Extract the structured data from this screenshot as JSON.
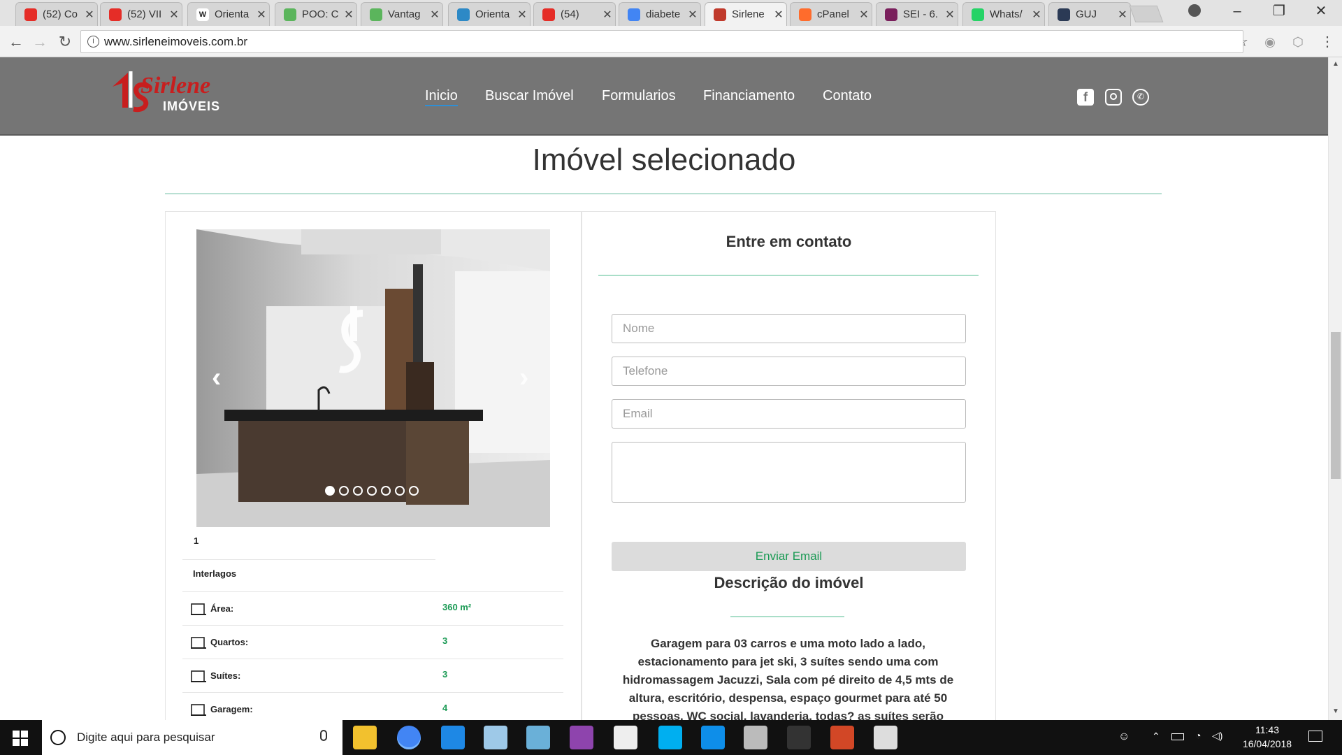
{
  "browser": {
    "tabs": [
      {
        "title": "(52) Co",
        "icon": "youtube-icon",
        "color": "#e52d27"
      },
      {
        "title": "(52) VII",
        "icon": "youtube-icon",
        "color": "#e52d27"
      },
      {
        "title": "Orienta",
        "icon": "wikipedia-icon",
        "color": "#ffffff"
      },
      {
        "title": "POO: C",
        "icon": "gear-icon",
        "color": "#5bb55c"
      },
      {
        "title": "Vantag",
        "icon": "gear-icon",
        "color": "#5bb55c"
      },
      {
        "title": "Orienta",
        "icon": "wordpress-icon",
        "color": "#2d89c6"
      },
      {
        "title": "(54)",
        "icon": "youtube-icon",
        "color": "#e52d27"
      },
      {
        "title": "diabete",
        "icon": "google-icon",
        "color": "#4285f4"
      },
      {
        "title": "Sirlene",
        "icon": "sirlene-icon",
        "color": "#c0392b"
      },
      {
        "title": "cPanel",
        "icon": "cpanel-icon",
        "color": "#ff6c2c"
      },
      {
        "title": "SEI - 6.",
        "icon": "sei-icon",
        "color": "#7a1f5c"
      },
      {
        "title": "Whats/",
        "icon": "whatsapp-icon",
        "color": "#25d366"
      },
      {
        "title": "GUJ",
        "icon": "guj-icon",
        "color": "#2b3a55"
      }
    ],
    "active_tab_index": 8,
    "url": "www.sirleneimoveis.com.br"
  },
  "site": {
    "logo_main": "Sirlene",
    "logo_sub": "IMÓVEIS",
    "menu": [
      "Inicio",
      "Buscar Imóvel",
      "Formularios",
      "Financiamento",
      "Contato"
    ],
    "social_icons": [
      "facebook-icon",
      "instagram-icon",
      "whatsapp-icon"
    ]
  },
  "page": {
    "title": "Imóvel selecionado",
    "carousel": {
      "slide_count": 7,
      "active_slide": 1
    },
    "image_caption": "1",
    "neighborhood": "Interlagos",
    "features": [
      {
        "label": "Área:",
        "value": "360 m²",
        "icon": "area-icon"
      },
      {
        "label": "Quartos:",
        "value": "3",
        "icon": "bed-icon"
      },
      {
        "label": "Suítes:",
        "value": "3",
        "icon": "bathtub-icon"
      },
      {
        "label": "Garagem:",
        "value": "4",
        "icon": "garage-icon"
      }
    ],
    "contact": {
      "title": "Entre em contato",
      "name_placeholder": "Nome",
      "phone_placeholder": "Telefone",
      "email_placeholder": "Email",
      "message_placeholder": "",
      "submit_label": "Enviar Email"
    },
    "description": {
      "title": "Descrição do imóvel",
      "lines": [
        "Garagem para 03 carros e uma moto lado a lado,",
        "estacionamento para jet ski, 3 suítes sendo uma com",
        "hidromassagem Jacuzzi, Sala com pé direito de 4,5 mts de",
        "altura, escritório, despensa, espaço gourmet para até 50",
        "pessoas, WC social, lavanderia, todas? as suítes serão"
      ]
    }
  },
  "taskbar": {
    "search_placeholder": "Digite aqui para pesquisar",
    "time": "11:43",
    "date": "16/04/2018"
  },
  "colors": {
    "accent_green": "#1a9a54",
    "teal_rule": "#a9dec8",
    "header_gray": "#757575"
  }
}
